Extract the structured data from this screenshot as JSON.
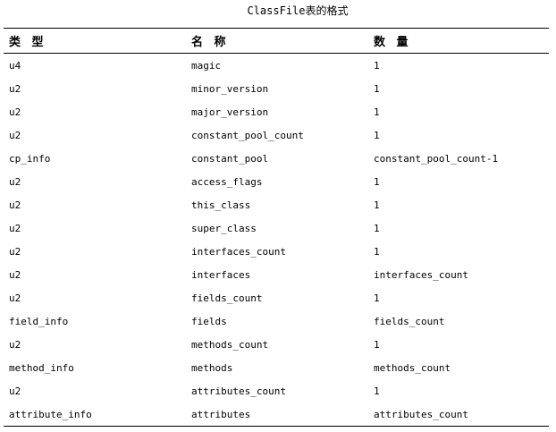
{
  "caption": "ClassFile表的格式",
  "headers": {
    "type": "类 型",
    "name": "名 称",
    "qty": "数 量"
  },
  "rows": [
    {
      "type": "u4",
      "name": "magic",
      "qty": "1"
    },
    {
      "type": "u2",
      "name": "minor_version",
      "qty": "1"
    },
    {
      "type": "u2",
      "name": "major_version",
      "qty": "1"
    },
    {
      "type": "u2",
      "name": "constant_pool_count",
      "qty": "1"
    },
    {
      "type": "cp_info",
      "name": "constant_pool",
      "qty": "constant_pool_count-1"
    },
    {
      "type": "u2",
      "name": "access_flags",
      "qty": "1"
    },
    {
      "type": "u2",
      "name": "this_class",
      "qty": "1"
    },
    {
      "type": "u2",
      "name": "super_class",
      "qty": "1"
    },
    {
      "type": "u2",
      "name": "interfaces_count",
      "qty": "1"
    },
    {
      "type": "u2",
      "name": "interfaces",
      "qty": "interfaces_count"
    },
    {
      "type": "u2",
      "name": "fields_count",
      "qty": "1"
    },
    {
      "type": "field_info",
      "name": "fields",
      "qty": "fields_count"
    },
    {
      "type": "u2",
      "name": "methods_count",
      "qty": "1"
    },
    {
      "type": "method_info",
      "name": "methods",
      "qty": "methods_count"
    },
    {
      "type": "u2",
      "name": "attributes_count",
      "qty": "1"
    },
    {
      "type": "attribute_info",
      "name": "attributes",
      "qty": "attributes_count"
    }
  ]
}
